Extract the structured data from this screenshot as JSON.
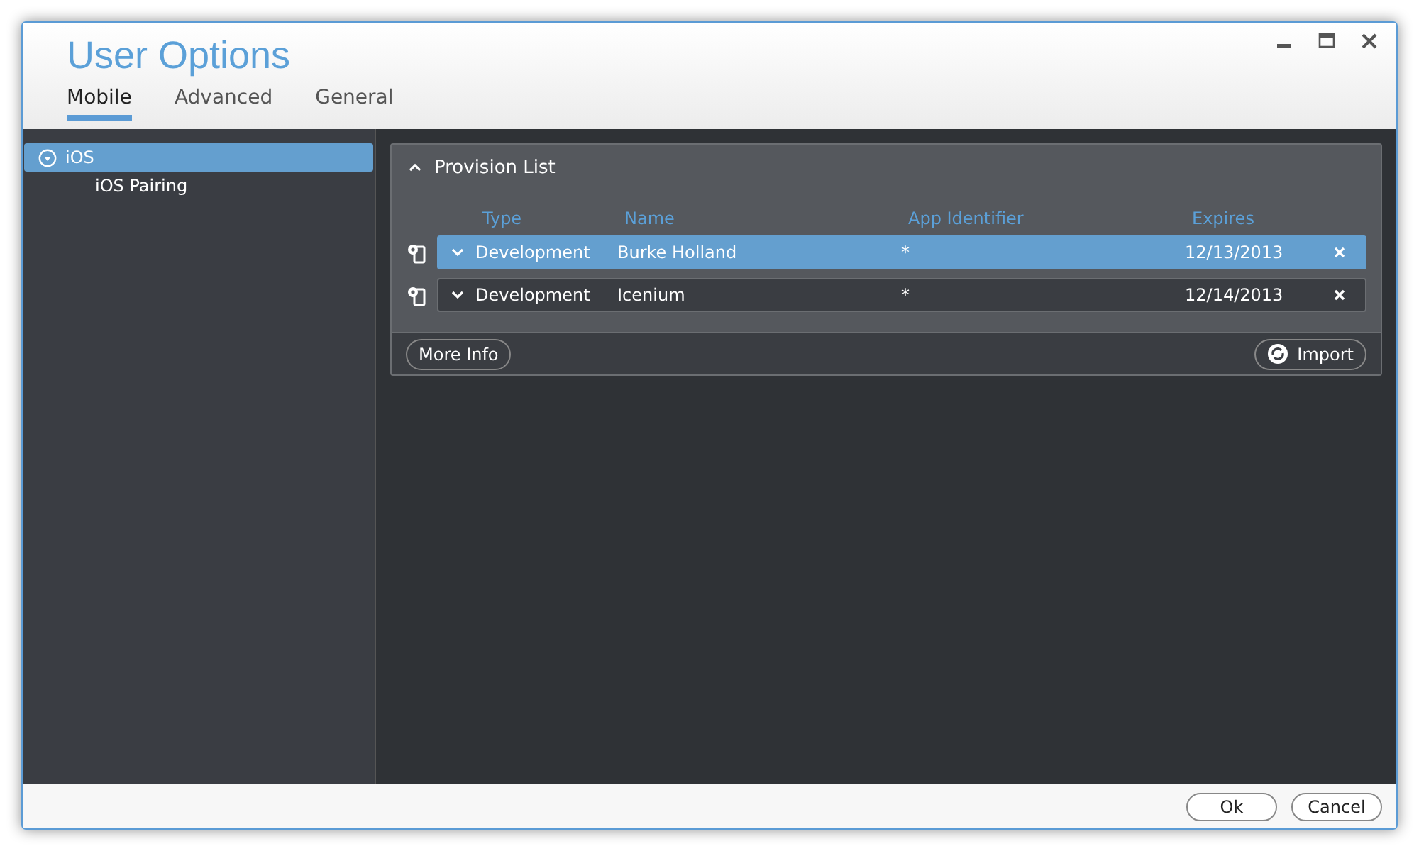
{
  "window": {
    "title": "User Options"
  },
  "tabs": [
    {
      "label": "Mobile",
      "selected": true
    },
    {
      "label": "Advanced",
      "selected": false
    },
    {
      "label": "General",
      "selected": false
    }
  ],
  "sidebar": {
    "items": [
      {
        "label": "iOS",
        "selected": true,
        "expanded": true,
        "children": [
          {
            "label": "iOS Pairing",
            "selected": false
          }
        ]
      }
    ]
  },
  "panel": {
    "title": "Provision List",
    "expanded": true,
    "columns": [
      "Type",
      "Name",
      "App Identifier",
      "Expires"
    ],
    "rows": [
      {
        "type": "Development",
        "name": "Burke Holland",
        "app_identifier": "*",
        "expires": "12/13/2013",
        "selected": true
      },
      {
        "type": "Development",
        "name": "Icenium",
        "app_identifier": "*",
        "expires": "12/14/2013",
        "selected": false
      }
    ],
    "more_info": "More Info",
    "import": "Import"
  },
  "buttons": [
    "Ok",
    "Cancel"
  ]
}
